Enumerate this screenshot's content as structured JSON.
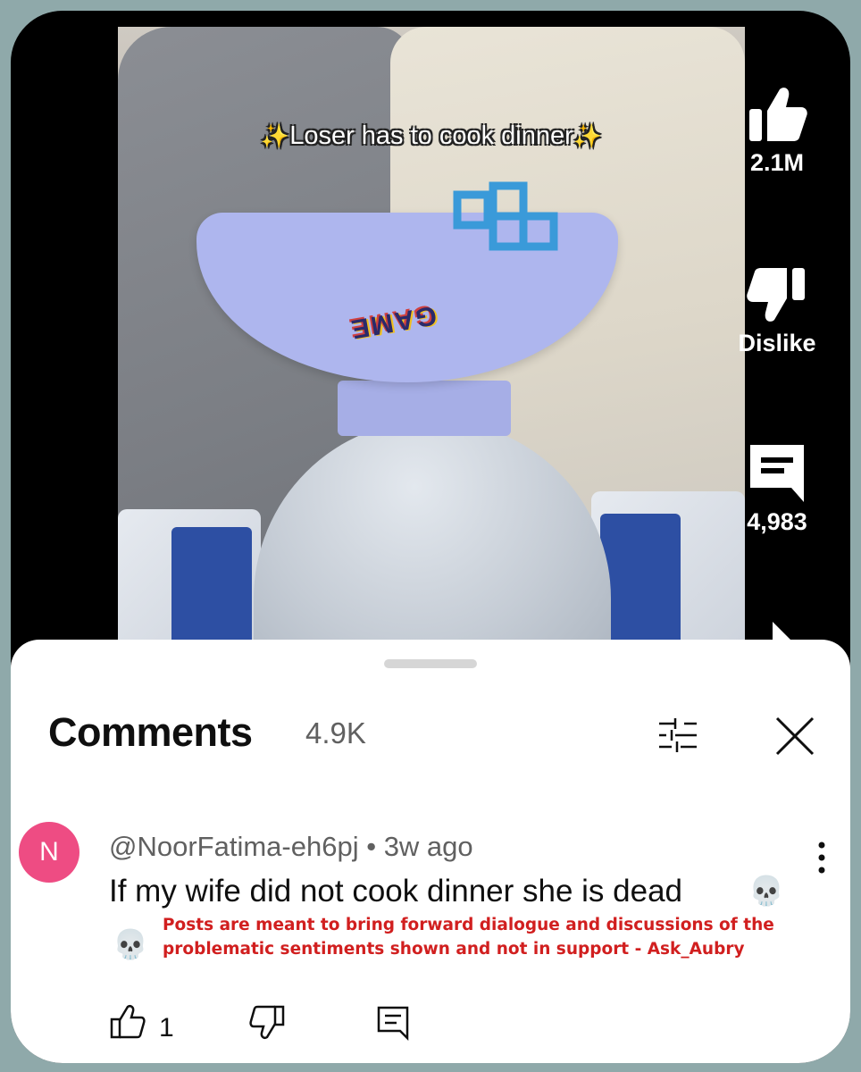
{
  "video": {
    "caption": "Loser has to cook dinner",
    "sparkle_icon": "sparkles-icon"
  },
  "rail": {
    "likes": "2.1M",
    "dislike_label": "Dislike",
    "comments": "4,983"
  },
  "comments_panel": {
    "title": "Comments",
    "count": "4.9K"
  },
  "comment": {
    "avatar_letter": "N",
    "avatar_color": "#ee4c83",
    "author": "@NoorFatima-eh6pj",
    "separator": "•",
    "time": "3w ago",
    "text": "If my wife did not cook dinner she is dead",
    "emoji": "💀",
    "overlay_note": "Posts are meant to bring forward dialogue and discussions of the problematic sentiments shown and not in support - Ask_Aubry",
    "like_count": "1"
  },
  "colors": {
    "background": "#8fa9aa",
    "overlay_red": "#d11f1f"
  }
}
